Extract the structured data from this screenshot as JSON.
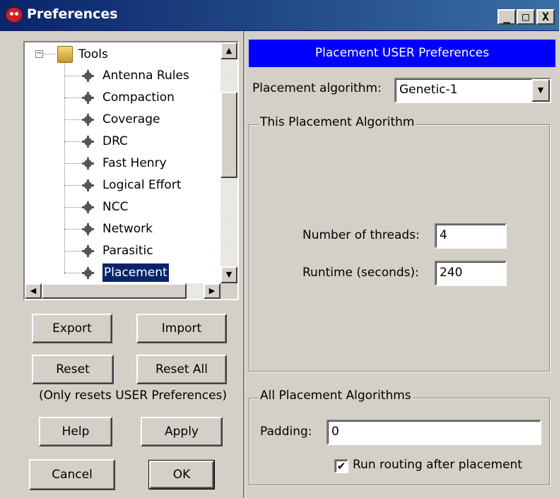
{
  "window": {
    "title": "Preferences",
    "minimize": "_",
    "maximize": "□",
    "close": "X"
  },
  "tree": {
    "root_label": "Tools",
    "items": [
      {
        "label": "Antenna Rules"
      },
      {
        "label": "Compaction"
      },
      {
        "label": "Coverage"
      },
      {
        "label": "DRC"
      },
      {
        "label": "Fast Henry"
      },
      {
        "label": "Logical Effort"
      },
      {
        "label": "NCC"
      },
      {
        "label": "Network"
      },
      {
        "label": "Parasitic"
      },
      {
        "label": "Placement",
        "selected": true
      }
    ]
  },
  "left_buttons": {
    "export": "Export",
    "import": "Import",
    "reset": "Reset",
    "reset_all": "Reset All",
    "reset_note": "(Only resets USER Preferences)",
    "help": "Help",
    "apply": "Apply",
    "cancel": "Cancel",
    "ok": "OK"
  },
  "panel": {
    "header": "Placement USER Preferences",
    "algorithm_label": "Placement algorithm:",
    "algorithm_value": "Genetic-1",
    "group1_title": "This Placement Algorithm",
    "threads_label": "Number of threads:",
    "threads_value": "4",
    "runtime_label": "Runtime (seconds):",
    "runtime_value": "240",
    "group2_title": "All Placement Algorithms",
    "padding_label": "Padding:",
    "padding_value": "0",
    "routing_label": "Run routing after placement",
    "routing_checked": true
  },
  "colors": {
    "header_bg": "#0000ff",
    "selection_bg": "#0a246a",
    "window_bg": "#d4d0c8"
  }
}
